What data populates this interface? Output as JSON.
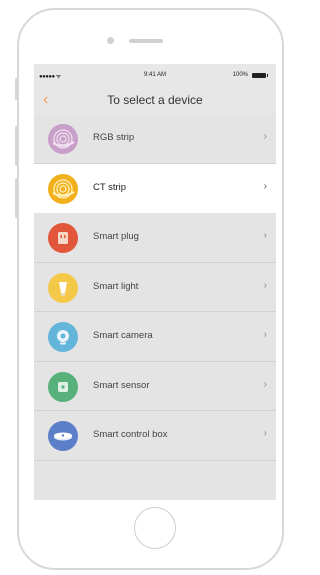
{
  "status_bar": {
    "carrier": "●●●●● ᯤ",
    "time": "9:41 AM",
    "battery": "100%"
  },
  "nav": {
    "back_glyph": "‹",
    "title": "To select a device"
  },
  "devices": [
    {
      "label": "RGB strip",
      "icon": "rgb-strip-icon",
      "color": "#c89fc8"
    },
    {
      "label": "CT strip",
      "icon": "ct-strip-icon",
      "color": "#f2b11c"
    },
    {
      "label": "Smart plug",
      "icon": "smart-plug-icon",
      "color": "#e2563c"
    },
    {
      "label": "Smart light",
      "icon": "smart-light-icon",
      "color": "#f4c94a"
    },
    {
      "label": "Smart camera",
      "icon": "smart-camera-icon",
      "color": "#63b5d9"
    },
    {
      "label": "Smart sensor",
      "icon": "smart-sensor-icon",
      "color": "#58b07a"
    },
    {
      "label": "Smart control box",
      "icon": "smart-control-box-icon",
      "color": "#5b7fc8"
    }
  ],
  "chevron_glyph": "›",
  "selected_device": "CT strip",
  "colors": {
    "accent": "#f0a05a",
    "screen_bg": "#e4e4e4",
    "selected_row_bg": "#ffffff"
  }
}
